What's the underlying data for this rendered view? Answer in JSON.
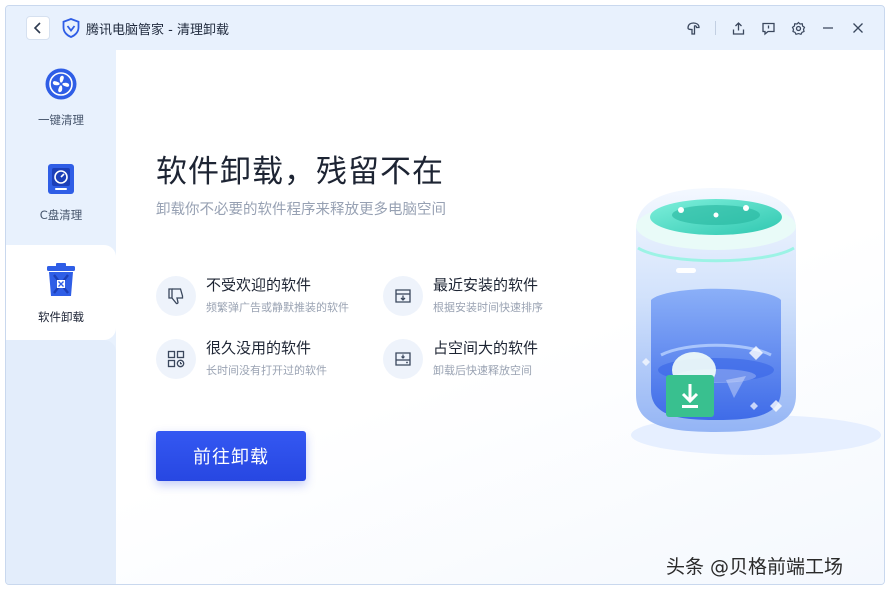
{
  "app": {
    "title": "腾讯电脑管家 - 清理卸载"
  },
  "window_controls": {
    "items": [
      "skin-icon",
      "share-icon",
      "feedback-icon",
      "settings-icon",
      "minimize-icon",
      "close-icon"
    ]
  },
  "sidebar": {
    "items": [
      {
        "label": "一键清理",
        "icon": "fan-clean-icon",
        "active": false
      },
      {
        "label": "C盘清理",
        "icon": "disk-clean-icon",
        "active": false
      },
      {
        "label": "软件卸载",
        "icon": "trash-uninstall-icon",
        "active": true
      }
    ]
  },
  "main": {
    "headline": "软件卸载，残留不在",
    "subline": "卸载你不必要的软件程序来释放更多电脑空间",
    "features": [
      {
        "title": "不受欢迎的软件",
        "desc": "频繁弹广告或静默推装的软件",
        "icon": "thumbs-down-icon"
      },
      {
        "title": "最近安装的软件",
        "desc": "根据安装时间快速排序",
        "icon": "inbox-download-icon"
      },
      {
        "title": "很久没用的软件",
        "desc": "长时间没有打开过的软件",
        "icon": "apps-clock-icon"
      },
      {
        "title": "占空间大的软件",
        "desc": "卸载后快速释放空间",
        "icon": "hard-drive-icon"
      }
    ],
    "button_label": "前往卸载"
  },
  "watermark": "头条 @贝格前端工场",
  "colors": {
    "accent": "#2747e2",
    "sidebar_bg": "#e8f1fd",
    "text_primary": "#1d2433",
    "text_muted": "#9aa3b3"
  }
}
